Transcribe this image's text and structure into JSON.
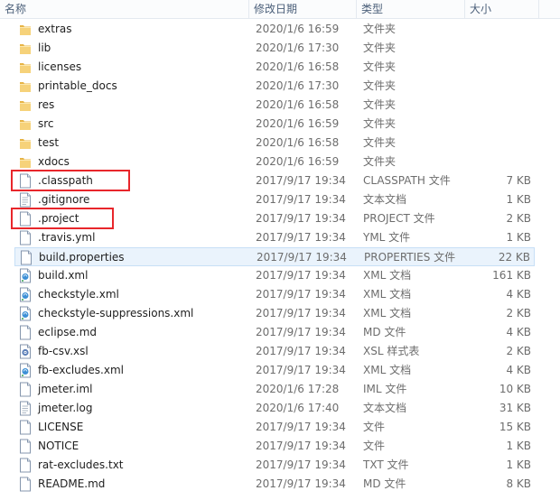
{
  "columns": {
    "name": "名称",
    "date": "修改日期",
    "type": "类型",
    "size": "大小"
  },
  "files": [
    {
      "name": "extras",
      "date": "2020/1/6 16:59",
      "type": "文件夹",
      "size": "",
      "icon": "folder-icon"
    },
    {
      "name": "lib",
      "date": "2020/1/6 17:30",
      "type": "文件夹",
      "size": "",
      "icon": "folder-icon"
    },
    {
      "name": "licenses",
      "date": "2020/1/6 16:58",
      "type": "文件夹",
      "size": "",
      "icon": "folder-icon"
    },
    {
      "name": "printable_docs",
      "date": "2020/1/6 17:30",
      "type": "文件夹",
      "size": "",
      "icon": "folder-icon"
    },
    {
      "name": "res",
      "date": "2020/1/6 16:58",
      "type": "文件夹",
      "size": "",
      "icon": "folder-icon"
    },
    {
      "name": "src",
      "date": "2020/1/6 16:59",
      "type": "文件夹",
      "size": "",
      "icon": "folder-icon"
    },
    {
      "name": "test",
      "date": "2020/1/6 16:58",
      "type": "文件夹",
      "size": "",
      "icon": "folder-icon"
    },
    {
      "name": "xdocs",
      "date": "2020/1/6 16:59",
      "type": "文件夹",
      "size": "",
      "icon": "folder-icon"
    },
    {
      "name": ".classpath",
      "date": "2017/9/17 19:34",
      "type": "CLASSPATH 文件",
      "size": "7 KB",
      "icon": "file-icon"
    },
    {
      "name": ".gitignore",
      "date": "2017/9/17 19:34",
      "type": "文本文档",
      "size": "1 KB",
      "icon": "text-file-icon"
    },
    {
      "name": ".project",
      "date": "2017/9/17 19:34",
      "type": "PROJECT 文件",
      "size": "2 KB",
      "icon": "file-icon"
    },
    {
      "name": ".travis.yml",
      "date": "2017/9/17 19:34",
      "type": "YML 文件",
      "size": "1 KB",
      "icon": "file-icon"
    },
    {
      "name": "build.properties",
      "date": "2017/9/17 19:34",
      "type": "PROPERTIES 文件",
      "size": "22 KB",
      "icon": "file-icon"
    },
    {
      "name": "build.xml",
      "date": "2017/9/17 19:34",
      "type": "XML 文档",
      "size": "161 KB",
      "icon": "xml-file-icon"
    },
    {
      "name": "checkstyle.xml",
      "date": "2017/9/17 19:34",
      "type": "XML 文档",
      "size": "4 KB",
      "icon": "xml-file-icon"
    },
    {
      "name": "checkstyle-suppressions.xml",
      "date": "2017/9/17 19:34",
      "type": "XML 文档",
      "size": "2 KB",
      "icon": "xml-file-icon"
    },
    {
      "name": "eclipse.md",
      "date": "2017/9/17 19:34",
      "type": "MD 文件",
      "size": "4 KB",
      "icon": "file-icon"
    },
    {
      "name": "fb-csv.xsl",
      "date": "2017/9/17 19:34",
      "type": "XSL 样式表",
      "size": "2 KB",
      "icon": "xsl-file-icon"
    },
    {
      "name": "fb-excludes.xml",
      "date": "2017/9/17 19:34",
      "type": "XML 文档",
      "size": "4 KB",
      "icon": "xml-file-icon"
    },
    {
      "name": "jmeter.iml",
      "date": "2020/1/6 17:28",
      "type": "IML 文件",
      "size": "10 KB",
      "icon": "file-icon"
    },
    {
      "name": "jmeter.log",
      "date": "2020/1/6 17:40",
      "type": "文本文档",
      "size": "31 KB",
      "icon": "text-file-icon"
    },
    {
      "name": "LICENSE",
      "date": "2017/9/17 19:34",
      "type": "文件",
      "size": "15 KB",
      "icon": "file-icon"
    },
    {
      "name": "NOTICE",
      "date": "2017/9/17 19:34",
      "type": "文件",
      "size": "1 KB",
      "icon": "file-icon"
    },
    {
      "name": "rat-excludes.txt",
      "date": "2017/9/17 19:34",
      "type": "TXT 文件",
      "size": "1 KB",
      "icon": "file-icon"
    },
    {
      "name": "README.md",
      "date": "2017/9/17 19:34",
      "type": "MD 文件",
      "size": "8 KB",
      "icon": "file-icon"
    }
  ],
  "selected_index": 12,
  "highlighted_names": [
    ".classpath",
    ".project"
  ],
  "colors": {
    "highlight_box": "#e8262b",
    "selection": "#eaf3fc",
    "folder": "#f2c55c"
  }
}
